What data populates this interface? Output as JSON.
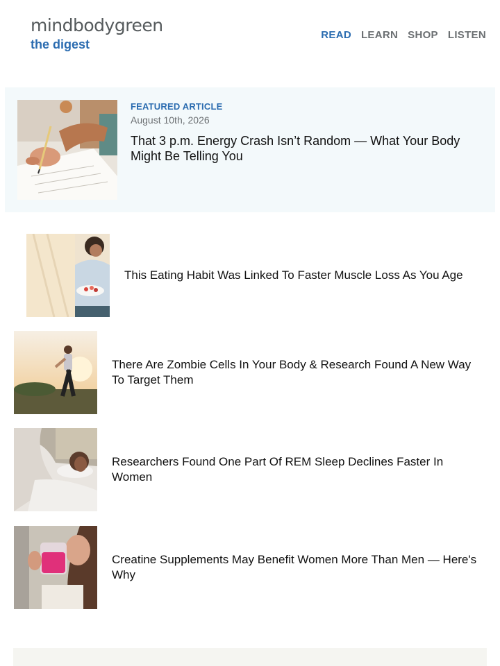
{
  "header": {
    "logo": {
      "brand": "mindbodygreen",
      "subtitle": "the digest"
    },
    "nav": [
      {
        "label": "READ",
        "active": true
      },
      {
        "label": "LEARN",
        "active": false
      },
      {
        "label": "SHOP",
        "active": false
      },
      {
        "label": "LISTEN",
        "active": false
      }
    ]
  },
  "featured": {
    "kicker": "FEATURED ARTICLE",
    "date": "August 10th, 2026",
    "title": "That 3 p.m. Energy Crash Isn’t Random — What Your Body Might Be Telling You",
    "image": "woman-writing-notebook-photo"
  },
  "articles": [
    {
      "title": "This Eating Habit Was Linked To Faster Muscle Loss As You Age",
      "image": "woman-eating-bowl-photo"
    },
    {
      "title": "There Are Zombie Cells In Your Body & Research Found A New Way To Target Them",
      "image": "woman-walking-sunset-photo"
    },
    {
      "title": "Researchers Found One Part Of REM Sleep Declines Faster In Women",
      "image": "woman-sleeping-photo"
    },
    {
      "title": "Creatine Supplements May Benefit Women More Than Men — Here's Why",
      "image": "woman-drinking-pink-photo"
    }
  ],
  "colors": {
    "accent": "#2b6cb0",
    "featured_bg": "#f3f9fb",
    "nav_inactive": "#6b6f72"
  }
}
